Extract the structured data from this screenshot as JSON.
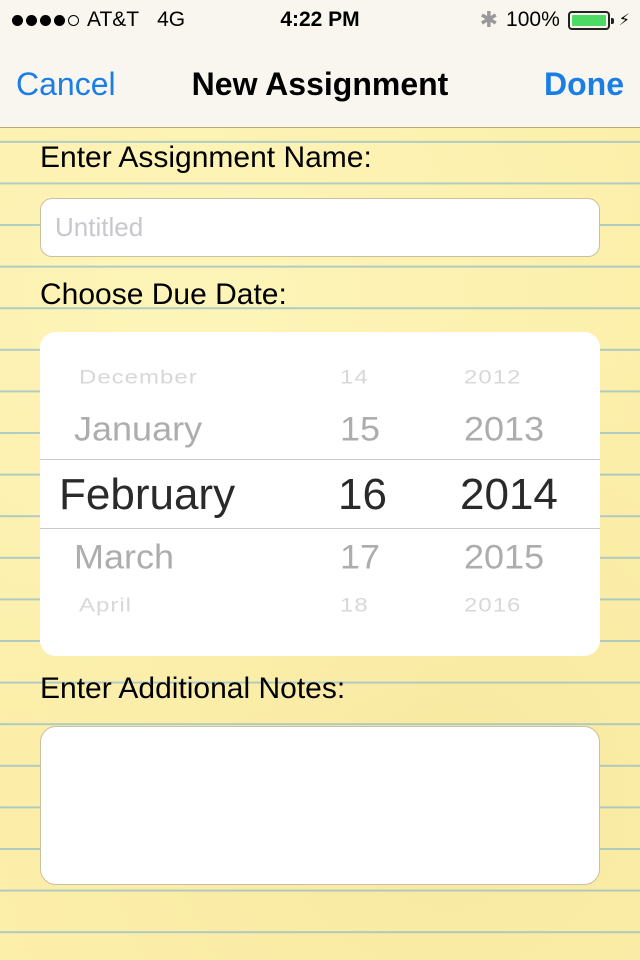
{
  "status_bar": {
    "signal_bars_filled": 4,
    "signal_bars_total": 5,
    "carrier": "AT&T",
    "network": "4G",
    "time": "4:22 PM",
    "bluetooth_icon": "bluetooth-icon",
    "battery_percent_text": "100%",
    "battery_level": 1.0,
    "charging_icon": "lightning-bolt-icon",
    "battery_color": "#4cd964"
  },
  "nav": {
    "cancel_label": "Cancel",
    "title": "New Assignment",
    "done_label": "Done",
    "accent_color": "#1a7ee6"
  },
  "form": {
    "name_label": "Enter Assignment Name:",
    "name_value": "",
    "name_placeholder": "Untitled",
    "due_date_label": "Choose Due Date:",
    "notes_label": "Enter Additional Notes:",
    "notes_value": ""
  },
  "date_picker": {
    "months": [
      "December",
      "January",
      "February",
      "March",
      "April"
    ],
    "days": [
      "14",
      "15",
      "16",
      "17",
      "18"
    ],
    "years": [
      "2012",
      "2013",
      "2014",
      "2015",
      "2016"
    ],
    "selected": {
      "month": "February",
      "day": "16",
      "year": "2014"
    }
  }
}
